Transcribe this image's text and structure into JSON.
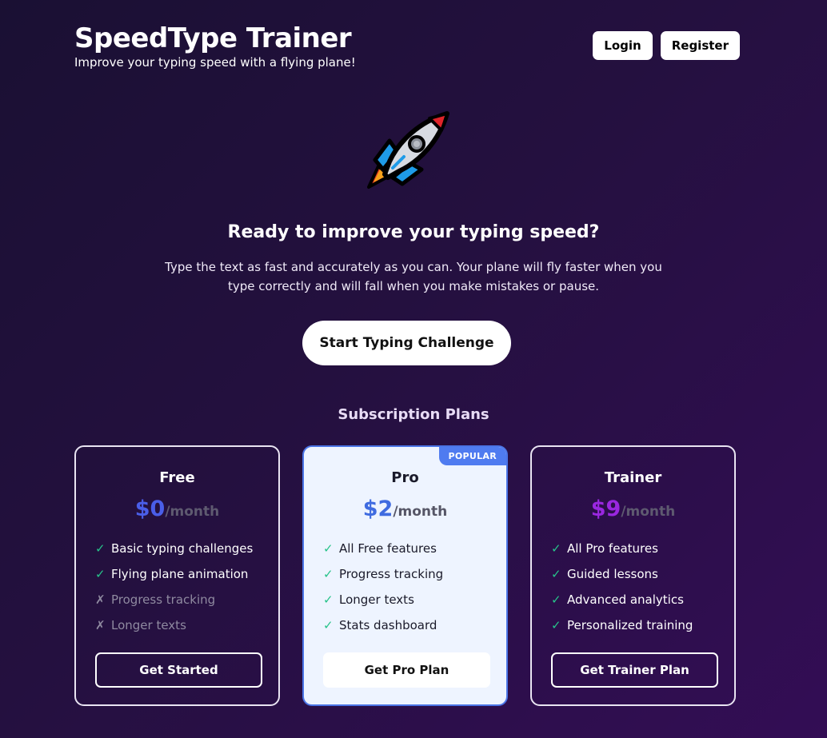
{
  "header": {
    "title": "SpeedType Trainer",
    "subtitle": "Improve your typing speed with a flying plane!",
    "login_label": "Login",
    "register_label": "Register"
  },
  "hero": {
    "icon": "rocket-icon",
    "title": "Ready to improve your typing speed?",
    "description": "Type the text as fast and accurately as you can. Your plane will fly faster when you type correctly and will fall when you make mistakes or pause.",
    "cta_label": "Start Typing Challenge"
  },
  "plans": {
    "title": "Subscription Plans",
    "items": [
      {
        "name": "Free",
        "price": "$0",
        "period": "/month",
        "price_color": "#4a5ee8",
        "features": [
          {
            "text": "Basic typing challenges",
            "mark": "✓"
          },
          {
            "text": "Flying plane animation",
            "mark": "✓"
          },
          {
            "text": "Progress tracking",
            "mark": "✗"
          },
          {
            "text": "Longer texts",
            "mark": "✗"
          }
        ],
        "button_label": "Get Started"
      },
      {
        "name": "Pro",
        "badge": "POPULAR",
        "price": "$2",
        "period": "/month",
        "price_color": "#3f6be0",
        "features": [
          {
            "text": "All Free features",
            "mark": "✓"
          },
          {
            "text": "Progress tracking",
            "mark": "✓"
          },
          {
            "text": "Longer texts",
            "mark": "✓"
          },
          {
            "text": "Stats dashboard",
            "mark": "✓"
          }
        ],
        "button_label": "Get Pro Plan"
      },
      {
        "name": "Trainer",
        "price": "$9",
        "period": "/month",
        "price_color": "#9a27e0",
        "features": [
          {
            "text": "All Pro features",
            "mark": "✓"
          },
          {
            "text": "Guided lessons",
            "mark": "✓"
          },
          {
            "text": "Advanced analytics",
            "mark": "✓"
          },
          {
            "text": "Personalized training",
            "mark": "✓"
          }
        ],
        "button_label": "Get Trainer Plan"
      }
    ]
  }
}
